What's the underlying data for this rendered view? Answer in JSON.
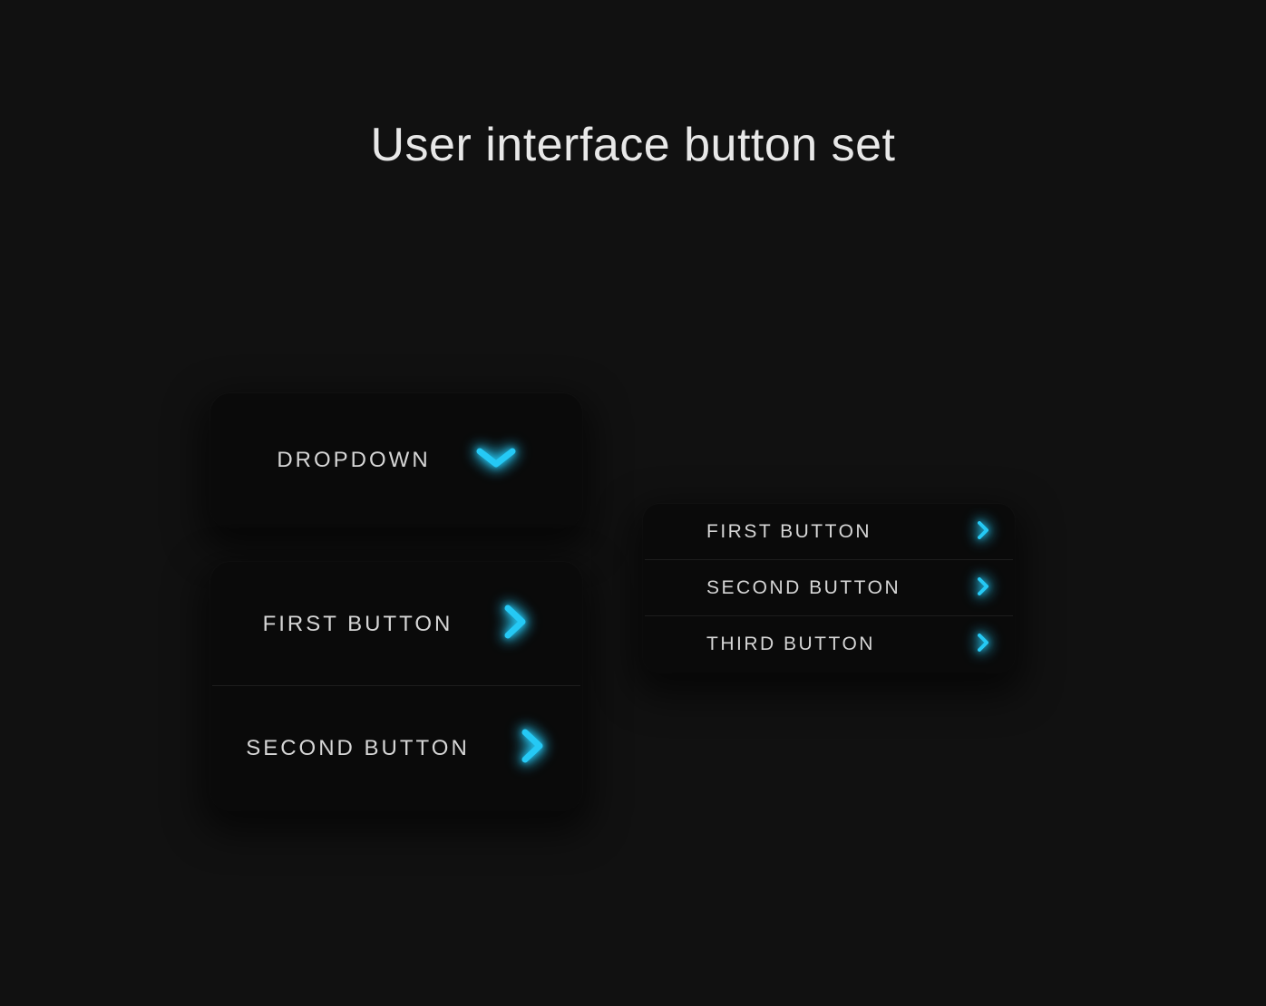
{
  "title": "User interface button set",
  "colors": {
    "accent": "#25c9f5",
    "text": "#d6d6d6",
    "background": "#111111",
    "panel": "#0a0a0a"
  },
  "dropdown": {
    "label": "DROPDOWN"
  },
  "largeList": {
    "items": [
      {
        "label": "FIRST BUTTON"
      },
      {
        "label": "SECOND BUTTON"
      }
    ]
  },
  "smallList": {
    "items": [
      {
        "label": "FIRST BUTTON"
      },
      {
        "label": "SECOND BUTTON"
      },
      {
        "label": "THIRD BUTTON"
      }
    ]
  }
}
